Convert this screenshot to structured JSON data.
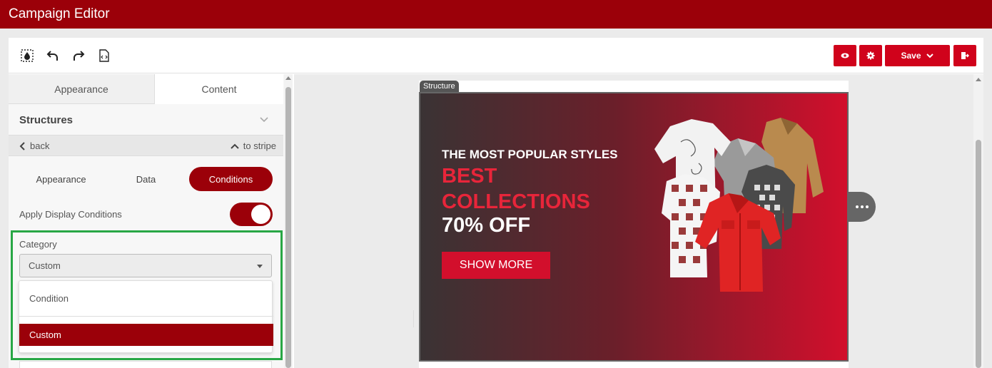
{
  "app": {
    "title": "Campaign Editor"
  },
  "toolbar": {
    "left_icons": [
      "drop-fill-icon",
      "undo-icon",
      "redo-icon",
      "code-file-icon"
    ],
    "save_label": "Save",
    "right_icons": [
      "eye-icon",
      "gear-icon",
      "chevron-down-icon",
      "exit-icon"
    ]
  },
  "left_panel": {
    "tabs": [
      {
        "label": "Appearance",
        "active": false
      },
      {
        "label": "Content",
        "active": true
      }
    ],
    "section_title": "Structures",
    "back_label": "back",
    "to_stripe_label": "to stripe",
    "subtabs": [
      {
        "label": "Appearance",
        "active": false
      },
      {
        "label": "Data",
        "active": false
      },
      {
        "label": "Conditions",
        "active": true
      }
    ],
    "apply_conditions_label": "Apply Display Conditions",
    "apply_conditions_on": true,
    "category": {
      "label": "Category",
      "selected": "Custom",
      "options": [
        "Condition",
        "Custom"
      ]
    }
  },
  "canvas": {
    "structure_tag": "Structure",
    "banner": {
      "line1": "THE MOST POPULAR STYLES",
      "line2": "BEST COLLECTIONS",
      "line3": "70% OFF",
      "button": "SHOW MORE"
    }
  },
  "colors": {
    "brand": "#9b0009",
    "accent": "#d20f2c",
    "highlight_box": "#28a745"
  }
}
